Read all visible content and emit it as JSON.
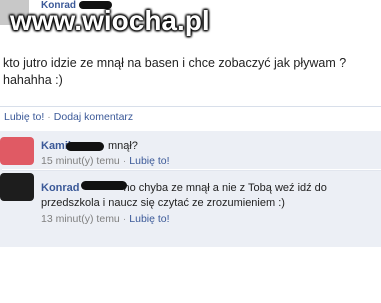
{
  "header": {
    "author": "Konrad",
    "watermark": "www.wiocha.pl"
  },
  "post": {
    "line1": "kto jutro idzie ze mnął na basen i chce zobaczyć jak pływam ?",
    "line2": "hahahha :)"
  },
  "actions": {
    "like": "Lubię to!",
    "separator": "·",
    "comment": "Dodaj komentarz"
  },
  "comments": [
    {
      "author": "Kamil",
      "text_after_blob": "mnął?",
      "time": "15 minut(y) temu",
      "separator": "·",
      "like": "Lubię to!"
    },
    {
      "author": "Konrad",
      "text_after_blob": "no chyba ze mnął a nie z Tobą weź idź do",
      "text_line2": "przedszkola i naucz się czytać ze zrozumieniem :)",
      "time": "13 minut(y) temu",
      "separator": "·",
      "like": "Lubię to!"
    }
  ]
}
